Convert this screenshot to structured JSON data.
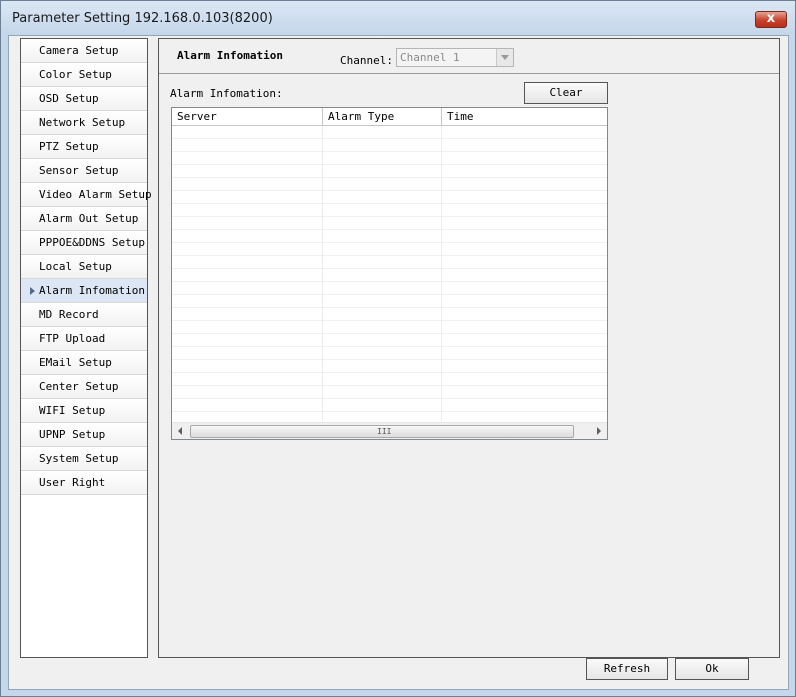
{
  "window": {
    "title": "Parameter Setting 192.168.0.103(8200)",
    "close_glyph": "x"
  },
  "sidebar": {
    "items": [
      {
        "label": "Camera Setup"
      },
      {
        "label": "Color Setup"
      },
      {
        "label": "OSD Setup"
      },
      {
        "label": "Network Setup"
      },
      {
        "label": "PTZ Setup"
      },
      {
        "label": "Sensor Setup"
      },
      {
        "label": "Video Alarm Setup"
      },
      {
        "label": "Alarm Out Setup"
      },
      {
        "label": "PPPOE&DDNS Setup"
      },
      {
        "label": "Local Setup"
      },
      {
        "label": "Alarm Infomation"
      },
      {
        "label": "MD Record"
      },
      {
        "label": "FTP Upload"
      },
      {
        "label": "EMail Setup"
      },
      {
        "label": "Center Setup"
      },
      {
        "label": "WIFI Setup"
      },
      {
        "label": "UPNP Setup"
      },
      {
        "label": "System Setup"
      },
      {
        "label": "User Right"
      }
    ],
    "selected": "Alarm Infomation"
  },
  "panel": {
    "title": "Alarm Infomation",
    "channel_label": "Channel:",
    "channel_value": "Channel 1",
    "info_label": "Alarm Infomation:",
    "clear_label": "Clear",
    "columns": [
      "Server",
      "Alarm Type",
      "Time"
    ],
    "scroll_grip": "III"
  },
  "footer": {
    "refresh_label": "Refresh",
    "ok_label": "Ok"
  },
  "colors": {
    "title_bar": "#c5d7ea",
    "close_button": "#c8422a",
    "selected_item": "#dce6f4",
    "panel_bg": "#f0f0f0"
  }
}
